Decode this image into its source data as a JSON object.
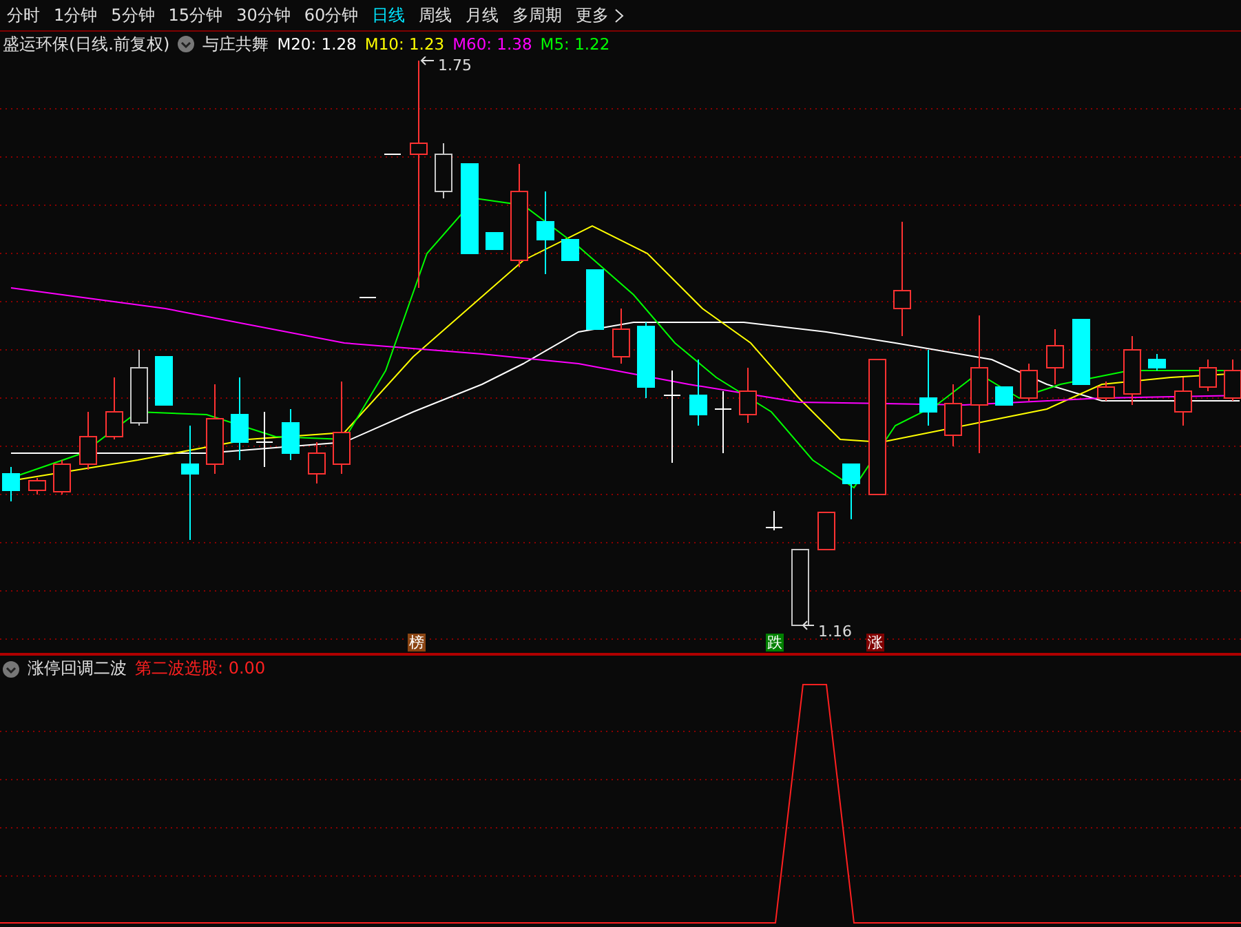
{
  "tabs": [
    {
      "label": "分时",
      "selected": false
    },
    {
      "label": "1分钟",
      "selected": false
    },
    {
      "label": "5分钟",
      "selected": false
    },
    {
      "label": "15分钟",
      "selected": false
    },
    {
      "label": "30分钟",
      "selected": false
    },
    {
      "label": "60分钟",
      "selected": false
    },
    {
      "label": "日线",
      "selected": true
    },
    {
      "label": "周线",
      "selected": false
    },
    {
      "label": "月线",
      "selected": false
    },
    {
      "label": "多周期",
      "selected": false
    }
  ],
  "more_menu": {
    "label": "更多"
  },
  "main_panel": {
    "title": "盛运环保(日线.前复权)",
    "indicator": "与庄共舞",
    "moving_averages": [
      {
        "label": "M20: 1.28",
        "color": "#ffffff"
      },
      {
        "label": "M10: 1.23",
        "color": "#ffff00"
      },
      {
        "label": "M60: 1.38",
        "color": "#ff00ff"
      },
      {
        "label": "M5: 1.22",
        "color": "#00ff00"
      }
    ],
    "price_labels": [
      "1.75",
      "1.16"
    ],
    "signals": [
      {
        "label": "榜",
        "color": "#8b4513"
      },
      {
        "label": "跌",
        "color": "#008000"
      },
      {
        "label": "涨",
        "color": "#800000"
      }
    ]
  },
  "sub_panel": {
    "title": "涨停回调二波",
    "reading": "第二波选股: 0.00"
  }
}
